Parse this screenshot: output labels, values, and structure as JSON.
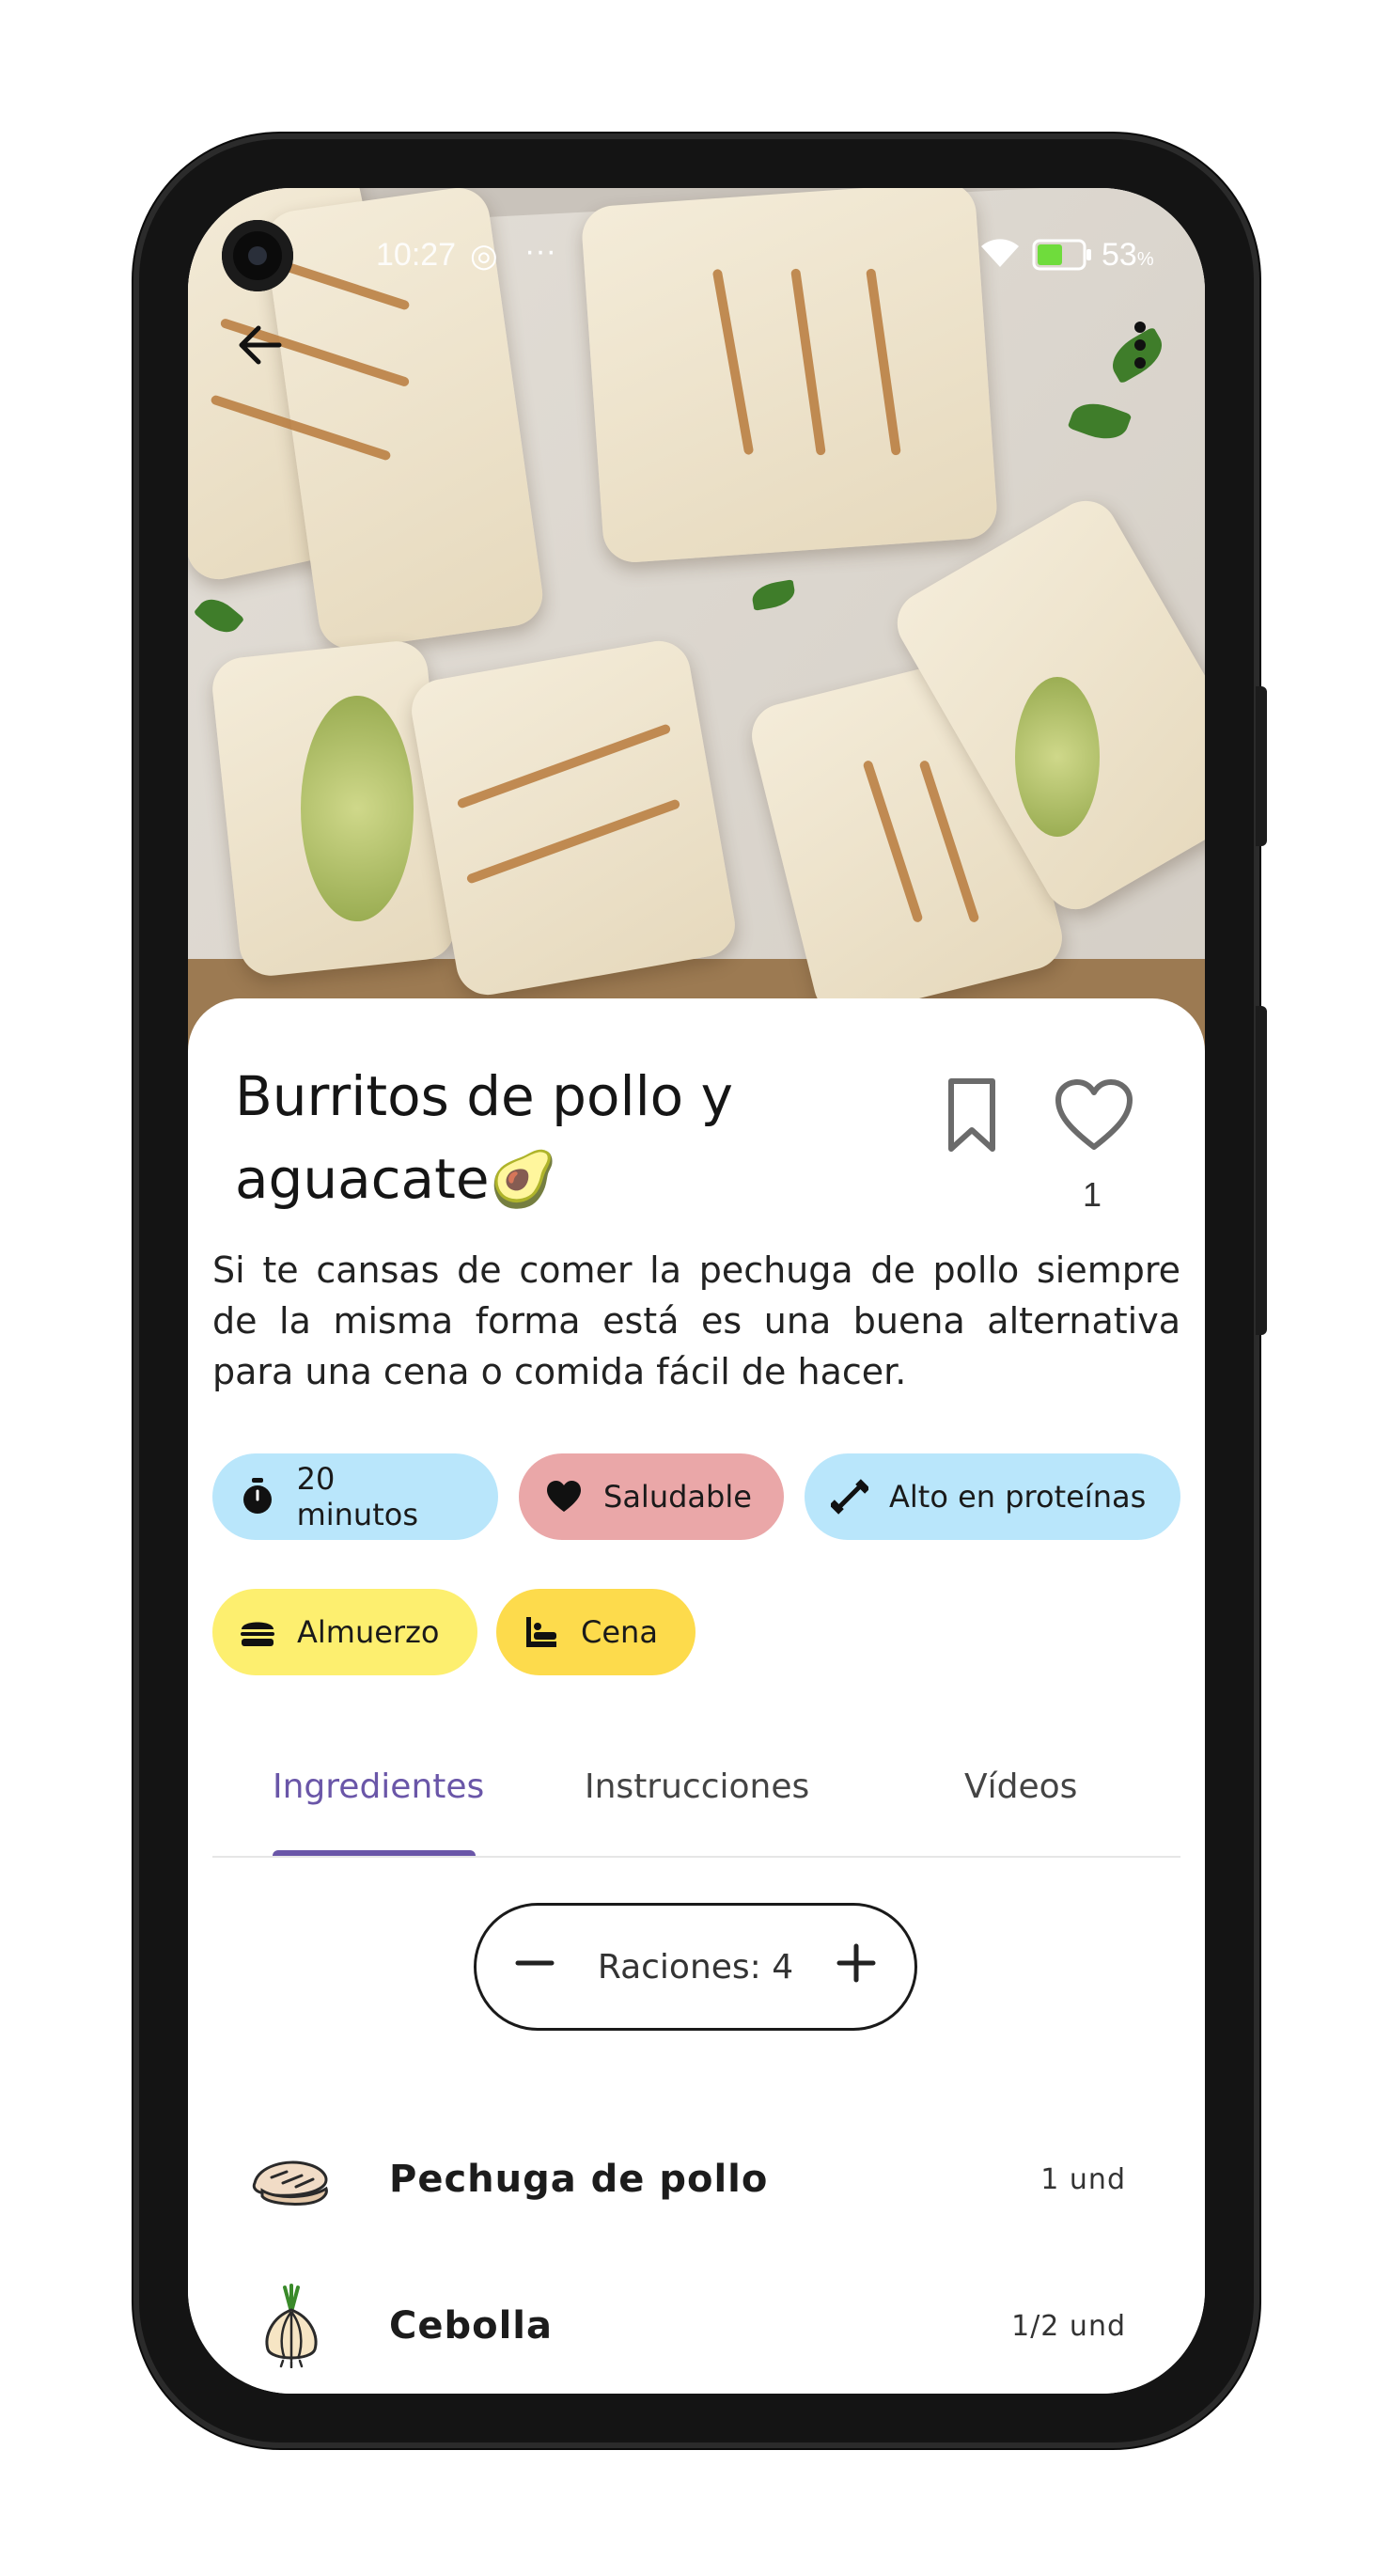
{
  "status_bar": {
    "time": "10:27",
    "battery": "53",
    "battery_unit": "%"
  },
  "header": {
    "back_icon": "arrow-left-icon",
    "menu_icon": "more-vertical-icon"
  },
  "recipe": {
    "title": "Burritos de pollo y aguacate🥑",
    "likes": "1",
    "description": "Si te cansas de comer la pechuga de pollo siempre de la misma forma está es una buena alternativa para una cena o comida fácil de hacer."
  },
  "chips": [
    {
      "label": "20 minutos",
      "icon": "stopwatch-icon",
      "color": "#b9e6fb"
    },
    {
      "label": "Saludable",
      "icon": "heart-icon",
      "color": "#eaa7a8"
    },
    {
      "label": "Alto en proteínas",
      "icon": "dumbbell-icon",
      "color": "#b9e6fb"
    },
    {
      "label": "Almuerzo",
      "icon": "burger-icon",
      "color": "#fdef6f"
    },
    {
      "label": "Cena",
      "icon": "dinner-icon",
      "color": "#fddb4c"
    }
  ],
  "tabs": [
    {
      "label": "Ingredientes",
      "active": true
    },
    {
      "label": "Instrucciones",
      "active": false
    },
    {
      "label": "Vídeos",
      "active": false
    }
  ],
  "servings": {
    "label": "Raciones: 4"
  },
  "ingredients": [
    {
      "name": "Pechuga de pollo",
      "qty": "1 und",
      "icon": "chicken-breast-icon"
    },
    {
      "name": "Cebolla",
      "qty": "1/2 und",
      "icon": "onion-icon"
    }
  ],
  "colors": {
    "accent": "#6a56a8",
    "text": "#151515"
  }
}
